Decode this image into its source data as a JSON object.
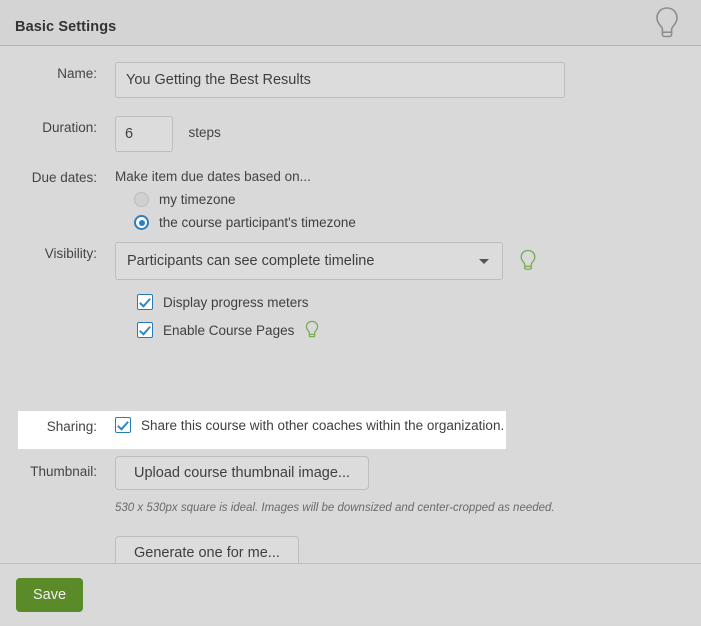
{
  "header": {
    "title": "Basic Settings",
    "help_icon": "lightbulb-icon"
  },
  "form": {
    "name": {
      "label": "Name:",
      "value": "You Getting the Best Results",
      "placeholder": ""
    },
    "duration": {
      "label": "Duration:",
      "value": "6",
      "unit": "steps"
    },
    "due_dates": {
      "label": "Due dates:",
      "intro": "Make item due dates based on...",
      "options": [
        {
          "label": "my timezone",
          "selected": false
        },
        {
          "label": "the course participant's timezone",
          "selected": true
        }
      ]
    },
    "visibility": {
      "label": "Visibility:",
      "selected": "Participants can see complete timeline",
      "help_icon": "lightbulb-icon",
      "checkboxes": [
        {
          "label": "Display progress meters",
          "checked": true,
          "help_icon": null
        },
        {
          "label": "Enable Course Pages",
          "checked": true,
          "help_icon": "lightbulb-icon"
        }
      ]
    },
    "sharing": {
      "label": "Sharing:",
      "checkbox_label": "Share this course with other coaches within the organization.",
      "checked": true
    },
    "thumbnail": {
      "label": "Thumbnail:",
      "upload_button": "Upload course thumbnail image...",
      "hint": "530 x 530px square is ideal. Images will be downsized and center-cropped as needed.",
      "generate_button": "Generate one for me..."
    }
  },
  "footer": {
    "save_label": "Save"
  },
  "colors": {
    "page_background": "#d9d9d9",
    "header_background": "#d4d4d4",
    "accent_blue": "#2a7fc4",
    "checkbox_blue": "#2a7ab0",
    "save_green": "#5b8a28",
    "hint_bulb_green": "#7aa952",
    "highlight_white": "#ffffff",
    "text": "#3f3f3f"
  }
}
